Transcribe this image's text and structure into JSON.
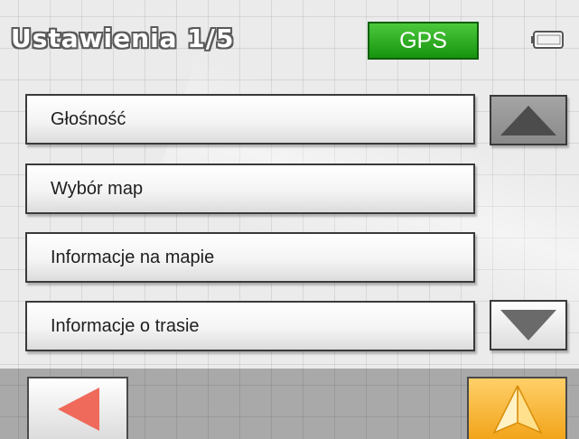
{
  "header": {
    "title": "Ustawienia 1/5",
    "gps_label": "GPS",
    "gps_color": "#2bb020",
    "battery_icon": "battery-icon"
  },
  "menu": {
    "items": [
      {
        "label": "Głośność"
      },
      {
        "label": "Wybór map"
      },
      {
        "label": "Informacje na mapie"
      },
      {
        "label": "Informacje o trasie"
      }
    ]
  },
  "controls": {
    "scroll_up_icon": "triangle-up-icon",
    "scroll_down_icon": "triangle-down-icon",
    "back_icon": "arrow-left-icon",
    "back_color": "#ef6a5a",
    "navigate_icon": "navigation-arrow-icon",
    "navigate_color": "#f6b52c"
  }
}
